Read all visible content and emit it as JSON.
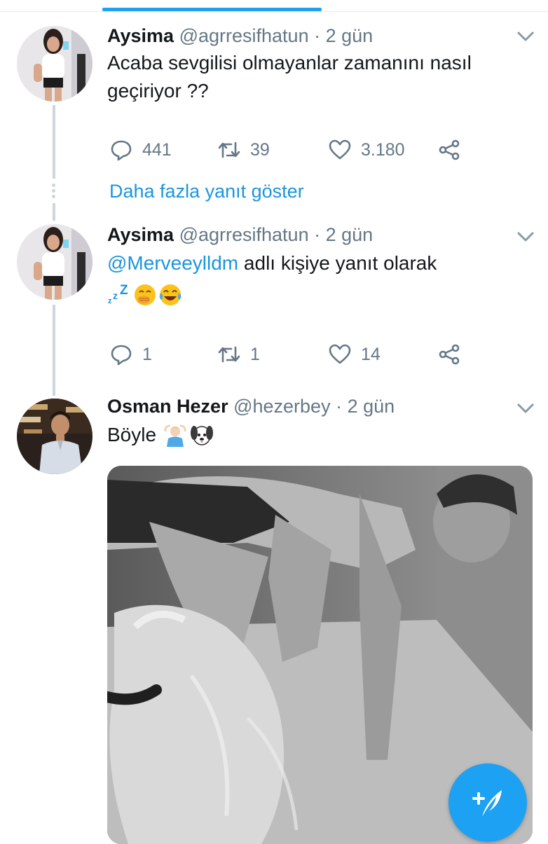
{
  "tweets": [
    {
      "name": "Aysima",
      "handle": "@agrresifhatun",
      "separator": "·",
      "time": "2 gün",
      "text_line1": "Acaba sevgilisi olmayanlar zamanını nasıl",
      "text_line2": "geçiriyor ??",
      "replies": "441",
      "retweets": "39",
      "likes": "3.180"
    },
    {
      "name": "Aysima",
      "handle": "@agrresifhatun",
      "separator": "·",
      "time": "2 gün",
      "mention": "@Merveeylldm",
      "reply_suffix": " adlı kişiye yanıt olarak",
      "emojis": [
        "sleeping-zzz",
        "face-with-hand-over-mouth",
        "face-with-tears-of-joy"
      ],
      "replies": "1",
      "retweets": "1",
      "likes": "14"
    },
    {
      "name": "Osman Hezer",
      "handle": "@hezerbey",
      "separator": "·",
      "time": "2 gün",
      "text": "Böyle",
      "emojis": [
        "man-gesturing-ok",
        "dog-face"
      ]
    }
  ],
  "thread": {
    "show_more": "Daha fazla yanıt göster"
  },
  "icons": {
    "reply": "reply-icon",
    "retweet": "retweet-icon",
    "like": "heart-icon",
    "share": "share-icon",
    "caret": "chevron-down-icon",
    "compose": "compose-tweet-icon"
  },
  "colors": {
    "accent": "#1da1f2",
    "link": "#1b95e0",
    "muted": "#657786",
    "text": "#14171a"
  }
}
